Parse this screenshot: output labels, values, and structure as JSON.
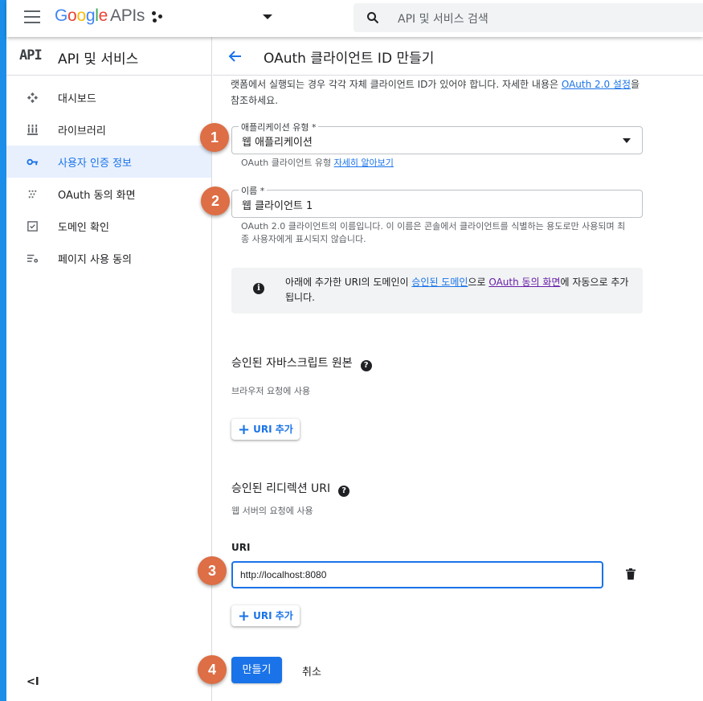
{
  "topbar": {
    "logo_g1": "G",
    "logo_g2": "o",
    "logo_g3": "o",
    "logo_g4": "g",
    "logo_g5": "l",
    "logo_g6": "e",
    "logo_suffix": "APIs",
    "search_placeholder": "API 및 서비스 검색"
  },
  "sidebar": {
    "badge": "API",
    "title": "API 및 서비스",
    "items": [
      {
        "label": "대시보드",
        "icon": "dashboard-icon",
        "active": false
      },
      {
        "label": "라이브러리",
        "icon": "library-icon",
        "active": false
      },
      {
        "label": "사용자 인증 정보",
        "icon": "key-icon",
        "active": true
      },
      {
        "label": "OAuth 동의 화면",
        "icon": "consent-icon",
        "active": false
      },
      {
        "label": "도메인 확인",
        "icon": "domain-check-icon",
        "active": false
      },
      {
        "label": "페이지 사용 동의",
        "icon": "page-settings-icon",
        "active": false
      }
    ],
    "collapse_glyph": "<I"
  },
  "header": {
    "title": "OAuth 클라이언트 ID 만들기"
  },
  "intro": {
    "text_before": "랫폼에서 실행되는 경우 각각 자체 클라이언트 ID가 있어야 합니다. 자세한 내용은 ",
    "link_text": "OAuth 2.0 설정",
    "text_after": "을 참조하세요."
  },
  "app_type": {
    "label": "애플리케이션 유형 *",
    "value": "웹 애플리케이션",
    "hint_prefix": "OAuth 클라이언트 유형 ",
    "hint_link": "자세히 알아보기"
  },
  "name": {
    "label": "이름 *",
    "value": "웹 클라이언트 1",
    "hint": "OAuth 2.0 클라이언트의 이름입니다. 이 이름은 콘솔에서 클라이언트를 식별하는 용도로만 사용되며 최종 사용자에게 표시되지 않습니다."
  },
  "info": {
    "icon": "i",
    "text_before": "아래에 추가한 URI의 도메인이 ",
    "link1": "승인된 도메인",
    "text_mid": "으로 ",
    "link2": "OAuth 동의 화면",
    "text_after": "에 자동으로 추가됩니다."
  },
  "js_origins": {
    "title": "승인된 자바스크립트 원본",
    "subtitle": "브라우저 요청에 사용",
    "add_button": "URI 추가"
  },
  "redirect_uris": {
    "title": "승인된 리디렉션 URI",
    "subtitle": "웹 서버의 요청에 사용",
    "uri_label": "URI",
    "uri_value": "http://localhost:8080",
    "add_button": "URI 추가"
  },
  "actions": {
    "create": "만들기",
    "cancel": "취소"
  },
  "annotations": [
    "1",
    "2",
    "3",
    "4"
  ],
  "colors": {
    "accent": "#1a73e8",
    "badge": "#dd6e45",
    "strip": "#1a8ee8"
  }
}
